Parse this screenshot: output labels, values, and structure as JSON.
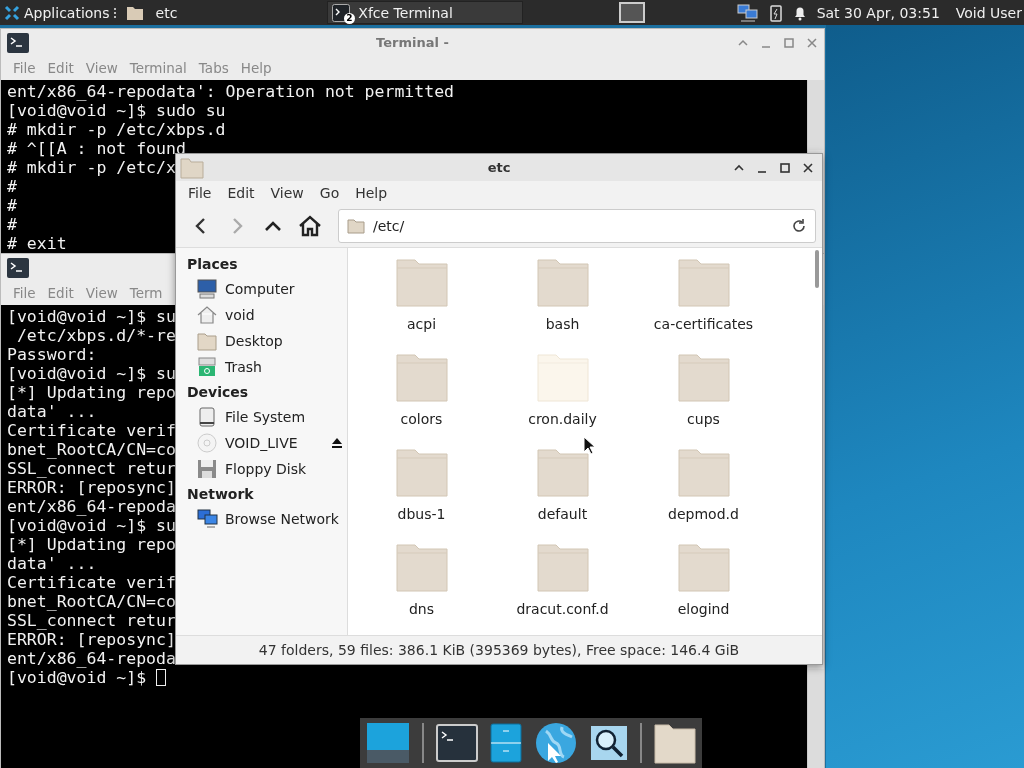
{
  "top_panel": {
    "applications_label": "Applications",
    "folder_label": "etc",
    "task_button": {
      "label": "Xfce Terminal",
      "count": "2"
    },
    "clock": "Sat 30 Apr, 03:51",
    "user": "Void User"
  },
  "terminals": [
    {
      "title": "Terminal -",
      "menu": [
        "File",
        "Edit",
        "View",
        "Terminal",
        "Tabs",
        "Help"
      ],
      "lines": [
        "ent/x86_64-repodata': Operation not permitted",
        "[void@void ~]$ sudo su",
        "# mkdir -p /etc/xbps.d",
        "# ^[[A : not found",
        "# mkdir -p /etc/x",
        "#",
        "#",
        "#",
        "# exit"
      ],
      "cursor": false
    },
    {
      "menu": [
        "File",
        "Edit",
        "View",
        "Term"
      ],
      "lines": [
        "[void@void ~]$ su",
        " /etc/xbps.d/*-re",
        "Password:",
        "[void@void ~]$ su",
        "[*] Updating repo",
        "data' ...",
        "Certificate verif",
        "bnet_RootCA/CN=co",
        "SSL_connect retur",
        "ERROR: [reposync]",
        "ent/x86_64-repoda",
        "[void@void ~]$ su",
        "[*] Updating repo",
        "data' ...",
        "Certificate verif",
        "bnet_RootCA/CN=co",
        "SSL_connect retur",
        "ERROR: [reposync]",
        "ent/x86_64-repoda",
        "[void@void ~]$ "
      ],
      "cursor": true
    }
  ],
  "file_manager": {
    "title": "etc",
    "menu": [
      "File",
      "Edit",
      "View",
      "Go",
      "Help"
    ],
    "toolbar": {
      "back_disabled": false,
      "forward_disabled": true
    },
    "address": "/etc/",
    "sidebar": [
      {
        "heading": "Places",
        "items": [
          {
            "label": "Computer",
            "ejectable": false
          },
          {
            "label": "void",
            "ejectable": false
          },
          {
            "label": "Desktop",
            "ejectable": false
          },
          {
            "label": "Trash",
            "ejectable": false
          }
        ]
      },
      {
        "heading": "Devices",
        "items": [
          {
            "label": "File System",
            "ejectable": false
          },
          {
            "label": "VOID_LIVE",
            "ejectable": true
          },
          {
            "label": "Floppy Disk",
            "ejectable": false
          }
        ]
      },
      {
        "heading": "Network",
        "items": [
          {
            "label": "Browse Network",
            "ejectable": false
          }
        ]
      }
    ],
    "folders": [
      {
        "name": "acpi",
        "highlighted": false
      },
      {
        "name": "bash",
        "highlighted": false
      },
      {
        "name": "ca-certificates",
        "highlighted": false
      },
      {
        "name": "colors",
        "highlighted": false
      },
      {
        "name": "cron.daily",
        "highlighted": true
      },
      {
        "name": "cups",
        "highlighted": false
      },
      {
        "name": "dbus-1",
        "highlighted": false
      },
      {
        "name": "default",
        "highlighted": false
      },
      {
        "name": "depmod.d",
        "highlighted": false
      },
      {
        "name": "dns",
        "highlighted": false
      },
      {
        "name": "dracut.conf.d",
        "highlighted": false
      },
      {
        "name": "elogind",
        "highlighted": false
      }
    ],
    "status": "47 folders, 59 files: 386.1 KiB (395369 bytes), Free space: 146.4 GiB"
  }
}
